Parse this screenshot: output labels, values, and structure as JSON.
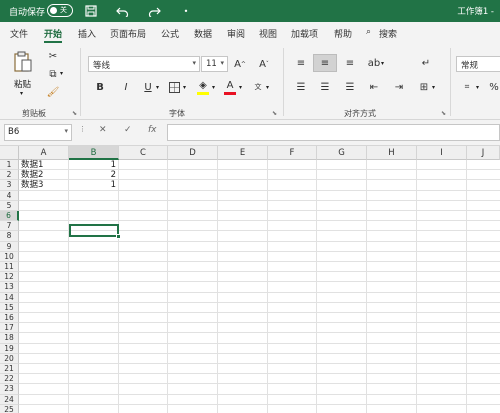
{
  "titlebar": {
    "autosave_label": "自动保存",
    "autosave_state": "关",
    "workbook_name": "工作簿1 -",
    "bg_color": "#217346"
  },
  "tabs": [
    "文件",
    "开始",
    "插入",
    "页面布局",
    "公式",
    "数据",
    "审阅",
    "视图",
    "加载项",
    "帮助",
    "搜索"
  ],
  "active_tab": "开始",
  "ribbon": {
    "clipboard": {
      "paste_label": "粘贴",
      "group_label": "剪贴板"
    },
    "font": {
      "font_name": "等线",
      "font_size": "11",
      "group_label": "字体"
    },
    "alignment": {
      "group_label": "对齐方式"
    },
    "number": {
      "format": "常规"
    }
  },
  "formula_bar": {
    "name_box": "B6",
    "formula": ""
  },
  "sheet": {
    "columns": [
      "A",
      "B",
      "C",
      "D",
      "E",
      "F",
      "G",
      "H",
      "I",
      "J"
    ],
    "rows": [
      "1",
      "2",
      "3",
      "4",
      "5",
      "6",
      "7",
      "8",
      "9",
      "10",
      "11",
      "12",
      "13",
      "14",
      "15",
      "16",
      "17",
      "18",
      "19",
      "20",
      "21",
      "22",
      "23",
      "24",
      "25"
    ],
    "selected_cell": "B6",
    "cells": [
      {
        "ref": "A1",
        "value": "数据1"
      },
      {
        "ref": "B1",
        "value": "1"
      },
      {
        "ref": "A2",
        "value": "数据2"
      },
      {
        "ref": "B2",
        "value": "2"
      },
      {
        "ref": "A3",
        "value": "数据3"
      },
      {
        "ref": "B3",
        "value": "1"
      }
    ]
  },
  "colors": {
    "accent": "#217346",
    "font_color_swatch": "#e81123",
    "highlight_swatch": "#ffff00"
  }
}
